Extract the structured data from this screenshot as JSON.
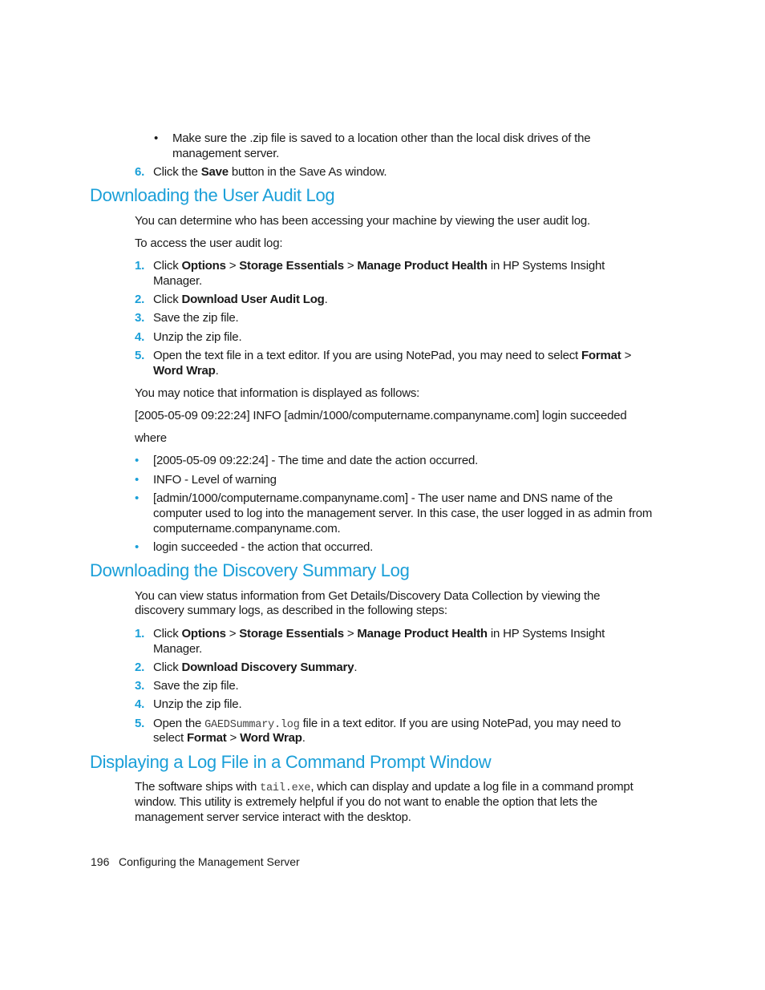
{
  "intro": {
    "bullet": "Make sure the .zip file is saved to a location other than the local disk drives of the",
    "bullet_cont": "management server.",
    "step6": {
      "num": "6.",
      "pre": "Click the ",
      "bold": "Save",
      "post": " button in the Save As window."
    }
  },
  "section1": {
    "title": "Downloading the User Audit Log",
    "p1": "You can determine who has been accessing your machine by viewing the user audit log.",
    "p2": "To access the user audit log:",
    "steps": [
      {
        "num": "1.",
        "a": "Click ",
        "b1": "Options",
        "s1": " > ",
        "b2": "Storage Essentials",
        "s2": " > ",
        "b3": "Manage Product Health",
        "c": " in HP Systems Insight",
        "cont": "Manager."
      },
      {
        "num": "2.",
        "a": "Click ",
        "b1": "Download User Audit Log",
        "c": "."
      },
      {
        "num": "3.",
        "a": "Save the zip file."
      },
      {
        "num": "4.",
        "a": "Unzip the zip file."
      },
      {
        "num": "5.",
        "a": "Open the text file in a text editor. If you are using NotePad, you may need to select ",
        "b1": "Format",
        "c": " >",
        "b2": "Word Wrap",
        "c2": "."
      }
    ],
    "p3": "You may notice that information is displayed as follows:",
    "example": "[2005-05-09 09:22:24] INFO [admin/1000/computername.companyname.com] login succeeded",
    "where": "where",
    "bullets": [
      {
        "text": "[2005-05-09 09:22:24] - The time and date the action occurred."
      },
      {
        "text": "INFO - Level of warning"
      },
      {
        "text": "[admin/1000/computername.companyname.com] - The user name and DNS name of the",
        "l2": "computer used to log into the management server. In this case, the user logged in as admin from",
        "l3": "computername.companyname.com."
      },
      {
        "text": "login succeeded - the action that occurred."
      }
    ]
  },
  "section2": {
    "title": "Downloading the Discovery Summary Log",
    "p1": "You can view status information from Get Details/Discovery Data Collection by viewing the",
    "p1b": "discovery summary logs, as described in the following steps:",
    "steps": [
      {
        "num": "1.",
        "a": "Click ",
        "b1": "Options",
        "s1": " > ",
        "b2": "Storage Essentials",
        "s2": " > ",
        "b3": "Manage Product Health",
        "c": " in HP Systems Insight",
        "cont": "Manager."
      },
      {
        "num": "2.",
        "a": "Click ",
        "b1": "Download Discovery Summary",
        "c": "."
      },
      {
        "num": "3.",
        "a": "Save the zip file."
      },
      {
        "num": "4.",
        "a": "Unzip the zip file."
      },
      {
        "num": "5.",
        "a": "Open the ",
        "code": "GAEDSummary.log",
        "c": " file in a text editor. If you are using NotePad, you may need to",
        "l2a": "select ",
        "b1": "Format",
        "s1": " > ",
        "b2": "Word Wrap",
        "c2": "."
      }
    ]
  },
  "section3": {
    "title": "Displaying a Log File in a Command Prompt Window",
    "p1a": "The software ships with ",
    "code": "tail.exe",
    "p1b": ", which can display and update a log file in a command prompt",
    "p1c": "window. This utility is extremely helpful if you do not want to enable the option that lets the",
    "p1d": "management server service interact with the desktop."
  },
  "footer": {
    "page_number": "196",
    "chapter": "Configuring the Management Server"
  }
}
